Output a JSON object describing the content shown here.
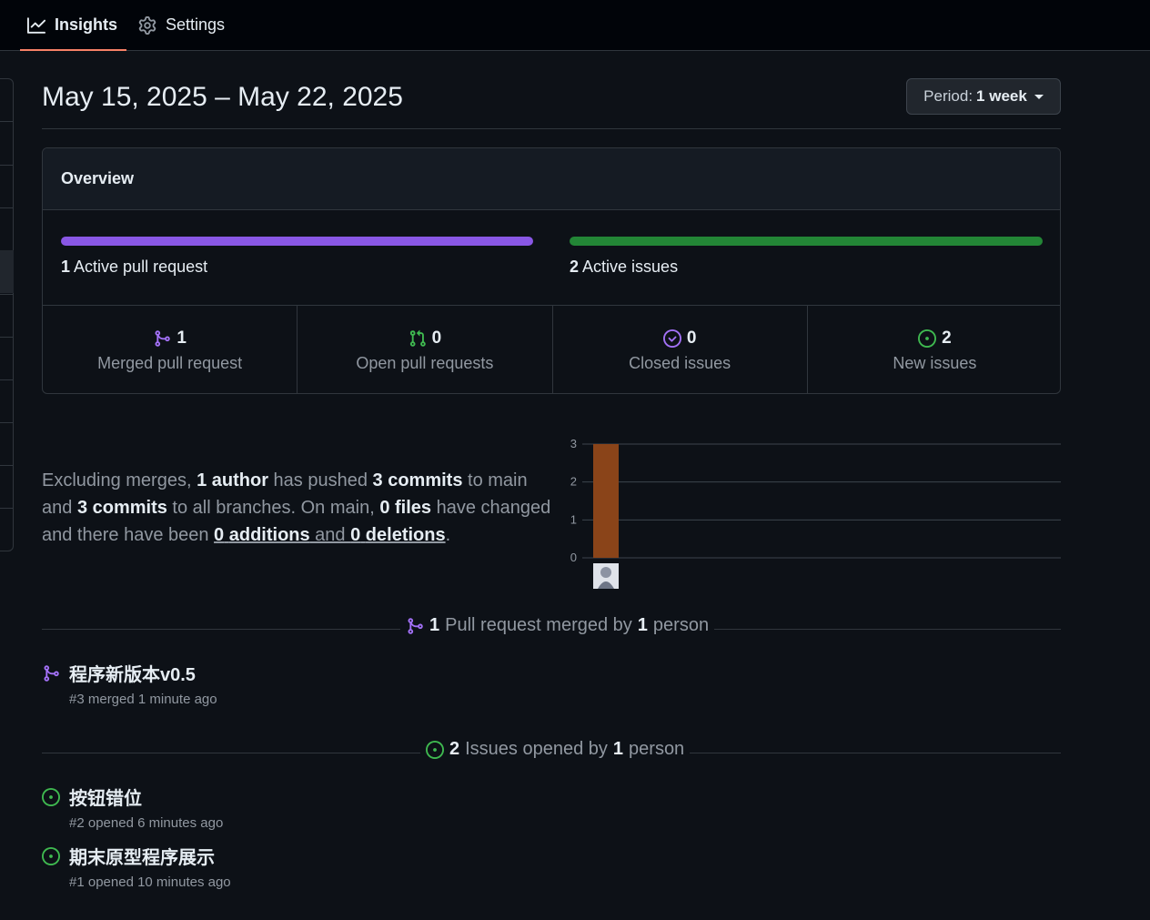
{
  "nav": {
    "tabs": [
      {
        "label": "Insights",
        "icon": "graph-icon",
        "active": true
      },
      {
        "label": "Settings",
        "icon": "gear-icon",
        "active": false
      }
    ]
  },
  "header": {
    "date_range": "May 15, 2025 – May 22, 2025",
    "period_label": "Period:",
    "period_value": "1 week"
  },
  "overview": {
    "title": "Overview",
    "active_prs_count": "1",
    "active_prs_label": "Active pull request",
    "active_issues_count": "2",
    "active_issues_label": "Active issues",
    "stats": [
      {
        "count": "1",
        "label": "Merged pull request",
        "icon": "git-merge-icon",
        "color": "#a371f7"
      },
      {
        "count": "0",
        "label": "Open pull requests",
        "icon": "git-pull-request-icon",
        "color": "#3fb950"
      },
      {
        "count": "0",
        "label": "Closed issues",
        "icon": "issue-closed-icon",
        "color": "#a371f7"
      },
      {
        "count": "2",
        "label": "New issues",
        "icon": "issue-opened-icon",
        "color": "#3fb950"
      }
    ]
  },
  "summary": {
    "t1": "Excluding merges, ",
    "authors": "1 author",
    "t2": " has pushed ",
    "commits_main": "3 commits",
    "t3": " to main and ",
    "commits_all": "3 commits",
    "t4": " to all branches. On main, ",
    "files": "0 files",
    "t5": " have changed and there have been ",
    "additions_n": "0",
    "additions_w": "additions",
    "t6": " and ",
    "deletions_n": "0",
    "deletions_w": "deletions",
    "t7": "."
  },
  "chart_data": {
    "type": "bar",
    "categories": [
      "author-1"
    ],
    "values": [
      3
    ],
    "ylim": [
      0,
      3
    ],
    "yticks": [
      "0",
      "1",
      "2",
      "3"
    ],
    "bar_color": "#8a4419",
    "grid": true
  },
  "pull_requests": {
    "count": "1",
    "t1": "Pull request merged by",
    "people": "1",
    "t2": "person",
    "items": [
      {
        "title": "程序新版本v0.5",
        "meta": "#3 merged 1 minute ago"
      }
    ]
  },
  "issues": {
    "count": "2",
    "t1": "Issues opened by",
    "people": "1",
    "t2": "person",
    "items": [
      {
        "title": "按钮错位",
        "meta": "#2 opened 6 minutes ago"
      },
      {
        "title": "期末原型程序展示",
        "meta": "#1 opened 10 minutes ago"
      }
    ]
  }
}
